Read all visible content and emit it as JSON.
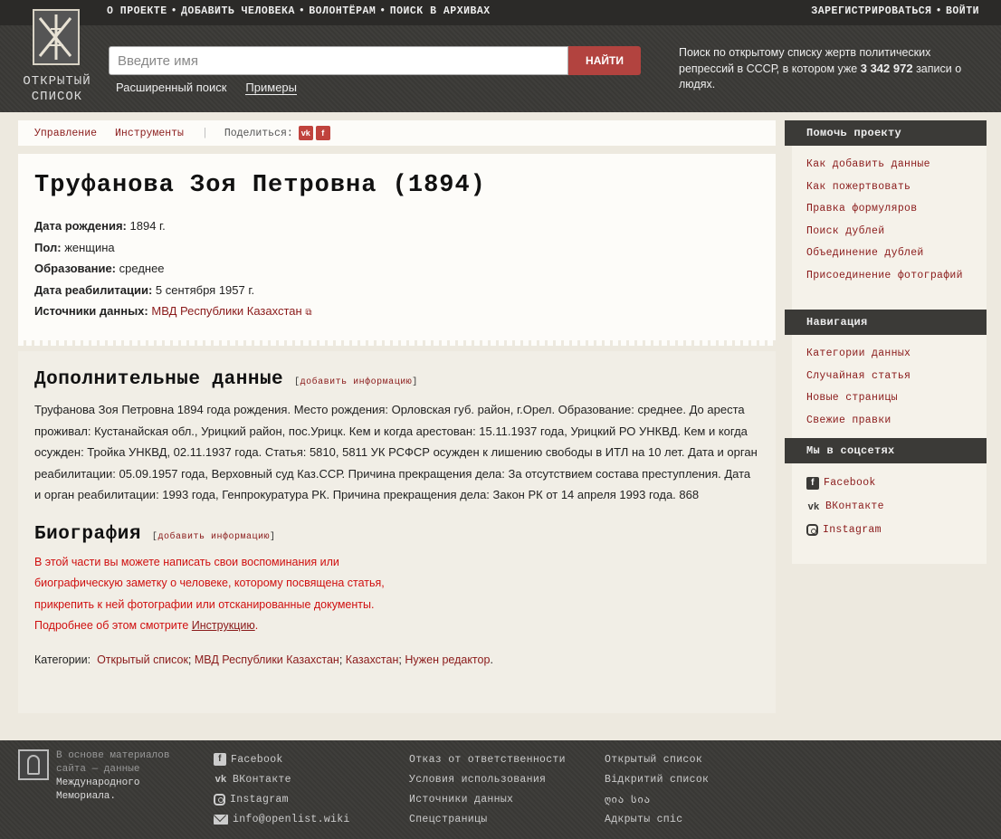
{
  "topnav": {
    "items": [
      "О ПРОЕКТЕ",
      "ДОБАВИТЬ ЧЕЛОВЕКА",
      "ВОЛОНТЁРАМ",
      "ПОИСК В АРХИВАХ"
    ],
    "separator": "•",
    "right": [
      "ЗАРЕГИСТРИРОВАТЬСЯ",
      "ВОЙТИ"
    ]
  },
  "logo": {
    "line1": "ОТКРЫТЫЙ",
    "line2": "СПИСОК"
  },
  "search": {
    "placeholder": "Введите имя",
    "button": "НАЙТИ",
    "advanced": "Расширенный поиск",
    "examples": "Примеры"
  },
  "header_desc": {
    "text_before": "Поиск по открытому списку жертв политических репрессий в СССР, в котором уже",
    "count": "3 342 972",
    "text_after": "записи о людях."
  },
  "toolbar": {
    "manage": "Управление",
    "tools": "Инструменты",
    "divider": "|",
    "share": "Поделиться:",
    "vk": "vk",
    "fb": "f"
  },
  "person": {
    "title": "Труфанова Зоя Петровна (1894)",
    "fields": [
      {
        "key": "Дата рождения:",
        "value": "1894 г."
      },
      {
        "key": "Пол:",
        "value": "женщина"
      },
      {
        "key": "Образование:",
        "value": "среднее"
      },
      {
        "key": "Дата реабилитации:",
        "value": "5 сентября 1957 г."
      },
      {
        "key": "Источники данных:",
        "value": "МВД Республики Казахстан"
      }
    ],
    "ext_link_icon": "⧉"
  },
  "extra": {
    "heading": "Дополнительные данные",
    "add": "добавить информацию",
    "open_br": "[",
    "close_br": "]",
    "text": "Труфанова Зоя Петровна 1894 года рождения. Место рождения: Орловская губ. район, г.Орел. Образование: среднее. До ареста проживал: Кустанайская обл., Урицкий район, пос.Урицк. Кем и когда арестован: 15.11.1937 года, Урицкий РО УНКВД. Кем и когда осужден: Тройка УНКВД, 02.11.1937 года. Статья: 5810, 5811 УК РСФСР осужден к лишению свободы в ИТЛ на 10 лет. Дата и орган реабилитации: 05.09.1957 года, Верховный суд Каз.ССР. Причина прекращения дела: За отсутствием состава преступления. Дата и орган реабилитации: 1993 года, Генпрокуратура РК. Причина прекращения дела: Закон РК от 14 апреля 1993 года. 868"
  },
  "bio": {
    "heading": "Биография",
    "add": "добавить информацию",
    "lines": [
      "В этой части вы можете написать свои воспоминания или",
      "биографическую заметку о человеке, которому посвящена статья,",
      "прикрепить к ней фотографии или отсканированные документы."
    ],
    "more_before": "Подробнее об этом смотрите",
    "more_link": "Инструкцию",
    "more_after": "."
  },
  "categories": {
    "label": "Категории:",
    "items": [
      "Открытый список",
      "МВД Республики Казахстан",
      "Казахстан",
      "Нужен редактор"
    ],
    "sep": ";",
    "end": "."
  },
  "sidebar": {
    "help": {
      "title": "Помочь проекту",
      "items": [
        "Как добавить данные",
        "Как пожертвовать",
        "Правка формуляров",
        "Поиск дублей",
        "Объединение дублей",
        "Присоединение фотографий"
      ]
    },
    "nav": {
      "title": "Навигация",
      "items": [
        "Категории данных",
        "Случайная статья",
        "Новые страницы",
        "Свежие правки"
      ]
    },
    "social": {
      "title": "Мы в соцсетях",
      "items": [
        "Facebook",
        "ВКонтакте",
        "Instagram"
      ]
    }
  },
  "footer": {
    "about_lines": [
      "В основе материалов",
      "сайта — данные"
    ],
    "about_strong": [
      "Международного",
      "Мемориала."
    ],
    "social": [
      "Facebook",
      "ВКонтакте",
      "Instagram",
      "info@openlist.wiki"
    ],
    "links": [
      "Отказ от ответственности",
      "Условия использования",
      "Источники данных",
      "Спецстраницы"
    ],
    "langs": [
      "Открытый список",
      "Відкритий список",
      "ღია სია",
      "Адкрыты спіс"
    ]
  }
}
